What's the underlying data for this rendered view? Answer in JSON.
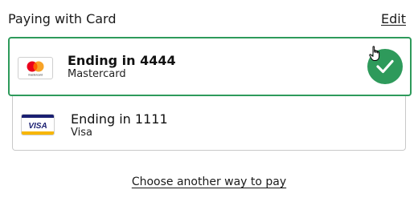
{
  "header": {
    "title": "Paying with Card",
    "edit_label": "Edit"
  },
  "cards": [
    {
      "ending": "Ending in 4444",
      "brand": "Mastercard",
      "logo_icon": "mastercard-logo",
      "logo_caption": "mastercard",
      "selected": true
    },
    {
      "ending": "Ending in 1111",
      "brand": "Visa",
      "logo_icon": "visa-logo",
      "logo_text": "VISA",
      "selected": false
    }
  ],
  "footer": {
    "alt_pay_label": "Choose another way to pay"
  },
  "colors": {
    "selected_border": "#2e9a5b",
    "check_badge": "#2e9a5b",
    "unselected_border": "#c9c9c9",
    "mastercard_red": "#eb001b",
    "mastercard_orange": "#f79e1b",
    "visa_blue": "#1a1f71",
    "visa_gold": "#f7b600"
  }
}
